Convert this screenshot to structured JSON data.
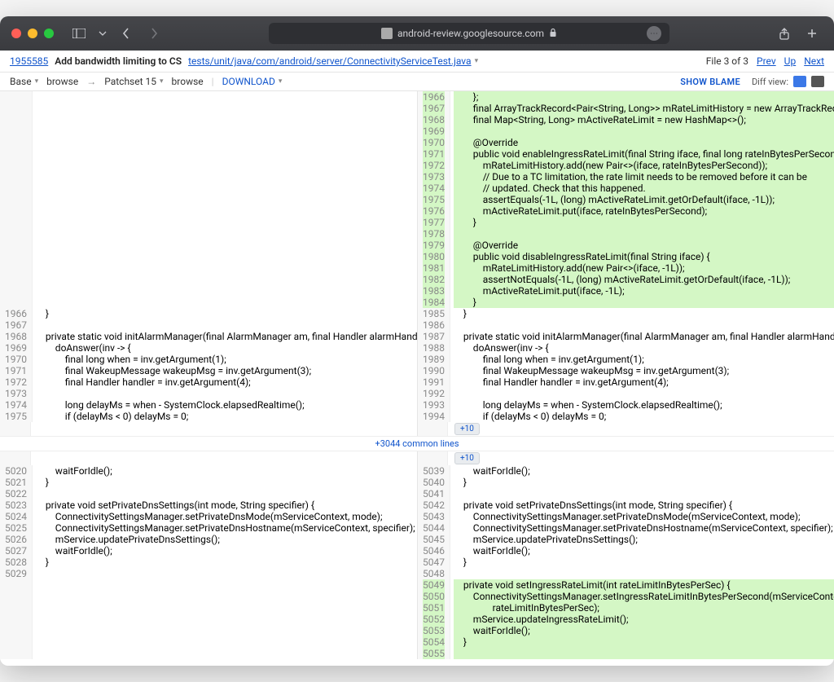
{
  "browser": {
    "url": "android-review.googlesource.com"
  },
  "header": {
    "change_id": "1955585",
    "subject": "Add bandwidth limiting to CS",
    "filepath": "tests/unit/java/com/android/server/ConnectivityServiceTest.java",
    "file_pos": "File 3 of 3",
    "prev": "Prev",
    "up": "Up",
    "next": "Next"
  },
  "patchbar": {
    "base": "Base",
    "browse1": "browse",
    "patchset": "Patchset 15",
    "browse2": "browse",
    "download": "DOWNLOAD",
    "show_blame": "SHOW BLAME",
    "diff_view": "Diff view:"
  },
  "common_lines": "+3044 common lines",
  "expand10": "+10",
  "left": {
    "block1": {
      "lines": [
        {
          "n": "1966",
          "t": "    }"
        },
        {
          "n": "1967",
          "t": ""
        },
        {
          "n": "1968",
          "t": "    private static void initAlarmManager(final AlarmManager am, final Handler alarmHandler) {"
        },
        {
          "n": "1969",
          "t": "        doAnswer(inv -> {"
        },
        {
          "n": "1970",
          "t": "            final long when = inv.getArgument(1);"
        },
        {
          "n": "1971",
          "t": "            final WakeupMessage wakeupMsg = inv.getArgument(3);"
        },
        {
          "n": "1972",
          "t": "            final Handler handler = inv.getArgument(4);"
        },
        {
          "n": "1973",
          "t": ""
        },
        {
          "n": "1974",
          "t": "            long delayMs = when - SystemClock.elapsedRealtime();"
        },
        {
          "n": "1975",
          "t": "            if (delayMs < 0) delayMs = 0;"
        }
      ]
    },
    "block2": {
      "lines": [
        {
          "n": "5020",
          "t": "        waitForIdle();"
        },
        {
          "n": "5021",
          "t": "    }"
        },
        {
          "n": "5022",
          "t": ""
        },
        {
          "n": "5023",
          "t": "    private void setPrivateDnsSettings(int mode, String specifier) {"
        },
        {
          "n": "5024",
          "t": "        ConnectivitySettingsManager.setPrivateDnsMode(mServiceContext, mode);"
        },
        {
          "n": "5025",
          "t": "        ConnectivitySettingsManager.setPrivateDnsHostname(mServiceContext, specifier);"
        },
        {
          "n": "5026",
          "t": "        mService.updatePrivateDnsSettings();"
        },
        {
          "n": "5027",
          "t": "        waitForIdle();"
        },
        {
          "n": "5028",
          "t": "    }"
        },
        {
          "n": "5029",
          "t": ""
        }
      ]
    }
  },
  "right": {
    "added1": {
      "lines": [
        {
          "n": "1966",
          "t": "        };"
        },
        {
          "n": "1967",
          "t": "        final ArrayTrackRecord<Pair<String, Long>> mRateLimitHistory = new ArrayTrackRecord<>();"
        },
        {
          "n": "1968",
          "t": "        final Map<String, Long> mActiveRateLimit = new HashMap<>();"
        },
        {
          "n": "1969",
          "t": ""
        },
        {
          "n": "1970",
          "t": "        @Override"
        },
        {
          "n": "1971",
          "t": "        public void enableIngressRateLimit(final String iface, final long rateInBytesPerSecond) {"
        },
        {
          "n": "1972",
          "t": "            mRateLimitHistory.add(new Pair<>(iface, rateInBytesPerSecond));"
        },
        {
          "n": "1973",
          "t": "            // Due to a TC limitation, the rate limit needs to be removed before it can be"
        },
        {
          "n": "1974",
          "t": "            // updated. Check that this happened."
        },
        {
          "n": "1975",
          "t": "            assertEquals(-1L, (long) mActiveRateLimit.getOrDefault(iface, -1L));"
        },
        {
          "n": "1976",
          "t": "            mActiveRateLimit.put(iface, rateInBytesPerSecond);"
        },
        {
          "n": "1977",
          "t": "        }"
        },
        {
          "n": "1978",
          "t": ""
        },
        {
          "n": "1979",
          "t": "        @Override"
        },
        {
          "n": "1980",
          "t": "        public void disableIngressRateLimit(final String iface) {"
        },
        {
          "n": "1981",
          "t": "            mRateLimitHistory.add(new Pair<>(iface, -1L));"
        },
        {
          "n": "1982",
          "t": "            assertNotEquals(-1L, (long) mActiveRateLimit.getOrDefault(iface, -1L));"
        },
        {
          "n": "1983",
          "t": "            mActiveRateLimit.put(iface, -1L);"
        },
        {
          "n": "1984",
          "t": "        }"
        }
      ]
    },
    "block1": {
      "lines": [
        {
          "n": "1985",
          "t": "    }"
        },
        {
          "n": "1986",
          "t": ""
        },
        {
          "n": "1987",
          "t": "    private static void initAlarmManager(final AlarmManager am, final Handler alarmHandler) {"
        },
        {
          "n": "1988",
          "t": "        doAnswer(inv -> {"
        },
        {
          "n": "1989",
          "t": "            final long when = inv.getArgument(1);"
        },
        {
          "n": "1990",
          "t": "            final WakeupMessage wakeupMsg = inv.getArgument(3);"
        },
        {
          "n": "1991",
          "t": "            final Handler handler = inv.getArgument(4);"
        },
        {
          "n": "1992",
          "t": ""
        },
        {
          "n": "1993",
          "t": "            long delayMs = when - SystemClock.elapsedRealtime();"
        },
        {
          "n": "1994",
          "t": "            if (delayMs < 0) delayMs = 0;"
        }
      ]
    },
    "block2": {
      "lines": [
        {
          "n": "5039",
          "t": "        waitForIdle();"
        },
        {
          "n": "5040",
          "t": "    }"
        },
        {
          "n": "5041",
          "t": ""
        },
        {
          "n": "5042",
          "t": "    private void setPrivateDnsSettings(int mode, String specifier) {"
        },
        {
          "n": "5043",
          "t": "        ConnectivitySettingsManager.setPrivateDnsMode(mServiceContext, mode);"
        },
        {
          "n": "5044",
          "t": "        ConnectivitySettingsManager.setPrivateDnsHostname(mServiceContext, specifier);"
        },
        {
          "n": "5045",
          "t": "        mService.updatePrivateDnsSettings();"
        },
        {
          "n": "5046",
          "t": "        waitForIdle();"
        },
        {
          "n": "5047",
          "t": "    }"
        },
        {
          "n": "5048",
          "t": ""
        }
      ]
    },
    "added2": {
      "lines": [
        {
          "n": "5049",
          "t": "    private void setIngressRateLimit(int rateLimitInBytesPerSec) {"
        },
        {
          "n": "5050",
          "t": "        ConnectivitySettingsManager.setIngressRateLimitInBytesPerSecond(mServiceContext,"
        },
        {
          "n": "5051",
          "t": "                rateLimitInBytesPerSec);"
        },
        {
          "n": "5052",
          "t": "        mService.updateIngressRateLimit();"
        },
        {
          "n": "5053",
          "t": "        waitForIdle();"
        },
        {
          "n": "5054",
          "t": "    }"
        },
        {
          "n": "5055",
          "t": ""
        }
      ]
    }
  }
}
